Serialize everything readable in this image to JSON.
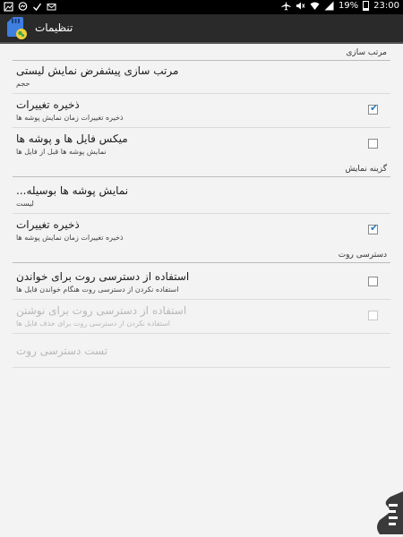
{
  "statusbar": {
    "battery": "19%",
    "time": "23:00"
  },
  "actionbar": {
    "title": "تنظیمات"
  },
  "categories": [
    {
      "label": "مرتب سازی"
    },
    {
      "label": "گزینه نمایش"
    },
    {
      "label": "دسترسی روت"
    }
  ],
  "items": [
    {
      "title": "مرتب سازی پیشفرض نمایش لیستی",
      "summary": "حجم",
      "checkbox": null,
      "enabled": true
    },
    {
      "title": "ذخیره تغییرات",
      "summary": "ذخیره تغییرات زمان نمایش پوشه ها",
      "checkbox": true,
      "enabled": true
    },
    {
      "title": "میکس فایل ها و پوشه ها",
      "summary": "نمایش پوشه ها قبل از فایل ها",
      "checkbox": false,
      "enabled": true
    },
    {
      "title": "نمایش پوشه ها بوسیله...",
      "summary": "لیست",
      "checkbox": null,
      "enabled": true
    },
    {
      "title": "ذخیره تغییرات",
      "summary": "ذخیره تغییرات زمان نمایش پوشه ها",
      "checkbox": true,
      "enabled": true
    },
    {
      "title": "استفاده از دسترسی روت برای خواندن",
      "summary": "استفاده نکردن از دسترسی روت هنگام خواندن فایل ها",
      "checkbox": false,
      "enabled": true
    },
    {
      "title": "استفاده از دسترسی روت برای نوشتن",
      "summary": "استفاده نکردن از دسترسی روت برای حذف فایل ها",
      "checkbox": false,
      "enabled": false
    },
    {
      "title": "تست دسترسی روت",
      "summary": "",
      "checkbox": null,
      "enabled": false
    }
  ],
  "colors": {
    "accent": "#2b7bc2",
    "actionbar": "#2a2a2a",
    "background": "#f3f3f3"
  },
  "icons": {
    "app": "sd-card-app-icon",
    "watermark": "brand-logo-icon"
  }
}
